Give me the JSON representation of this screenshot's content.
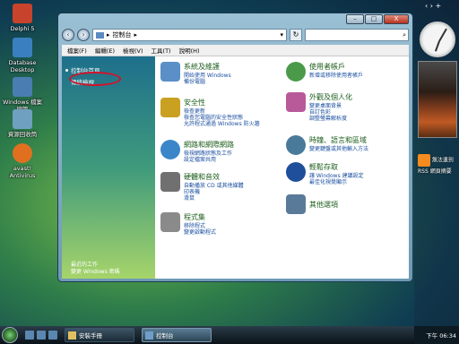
{
  "desktop": {
    "icons": [
      {
        "label": "Delphi 5",
        "color": "#c8432b"
      },
      {
        "label": "Database Desktop",
        "color": "#3a7fbf"
      },
      {
        "label": "Windows 檔案總管",
        "color": "#4a7db0"
      },
      {
        "label": "資源回收筒",
        "color": "#6fa0c0"
      },
      {
        "label": "avast! Antivirus",
        "color": "#e07020"
      }
    ]
  },
  "gadgets": {
    "rss_label": "無法連到 RSS 網頁摘要"
  },
  "window": {
    "address": "控制台",
    "controls": {
      "minimize": "–",
      "maximize": "□",
      "close": "X"
    }
  },
  "menu": [
    "檔案(F)",
    "編輯(E)",
    "檢視(V)",
    "工具(T)",
    "說明(H)"
  ],
  "left_pane": {
    "home": "控制台首頁",
    "classic": "傳統檢視",
    "recent_title": "最近的工作",
    "recent_item": "變更 Windows 密碼"
  },
  "categories": [
    {
      "title": "系統及維護",
      "links": [
        "開始使用 Windows",
        "備份電腦"
      ],
      "color": "#5a8fc8"
    },
    {
      "title": "使用者帳戶",
      "links": [
        "新增或移除使用者帳戶"
      ],
      "color": "#4a9a4a"
    },
    {
      "title": "安全性",
      "links": [
        "檢查更新",
        "檢查您電腦的安全性狀態",
        "允許程式通過 Windows 防火牆"
      ],
      "color": "#c9a020"
    },
    {
      "title": "外觀及個人化",
      "links": [
        "變更桌面背景",
        "自訂色彩",
        "調整螢幕解析度"
      ],
      "color": "#b85a9a"
    },
    {
      "title": "網路和網際網路",
      "links": [
        "檢視網路狀態及工作",
        "設定檔案共用"
      ],
      "color": "#3a86c8"
    },
    {
      "title": "時鐘、語言和區域",
      "links": [
        "變更鍵盤或其他輸入方法"
      ],
      "color": "#4a7a9a"
    },
    {
      "title": "硬體和音效",
      "links": [
        "自動播放 CD 或其他媒體",
        "印表機",
        "滑鼠"
      ],
      "color": "#707070"
    },
    {
      "title": "輕鬆存取",
      "links": [
        "讓 Windows 建議設定",
        "最佳化視覺顯示"
      ],
      "color": "#1f4f9a"
    },
    {
      "title": "程式集",
      "links": [
        "移除程式",
        "變更啟動程式"
      ],
      "color": "#8a8a8a"
    },
    {
      "title": "其他選項",
      "links": [],
      "color": "#5a7a9a"
    }
  ],
  "taskbar": {
    "buttons": [
      {
        "label": "安裝手冊",
        "active": false
      },
      {
        "label": "控制台",
        "active": true
      }
    ],
    "clock": "下午 06:34"
  }
}
